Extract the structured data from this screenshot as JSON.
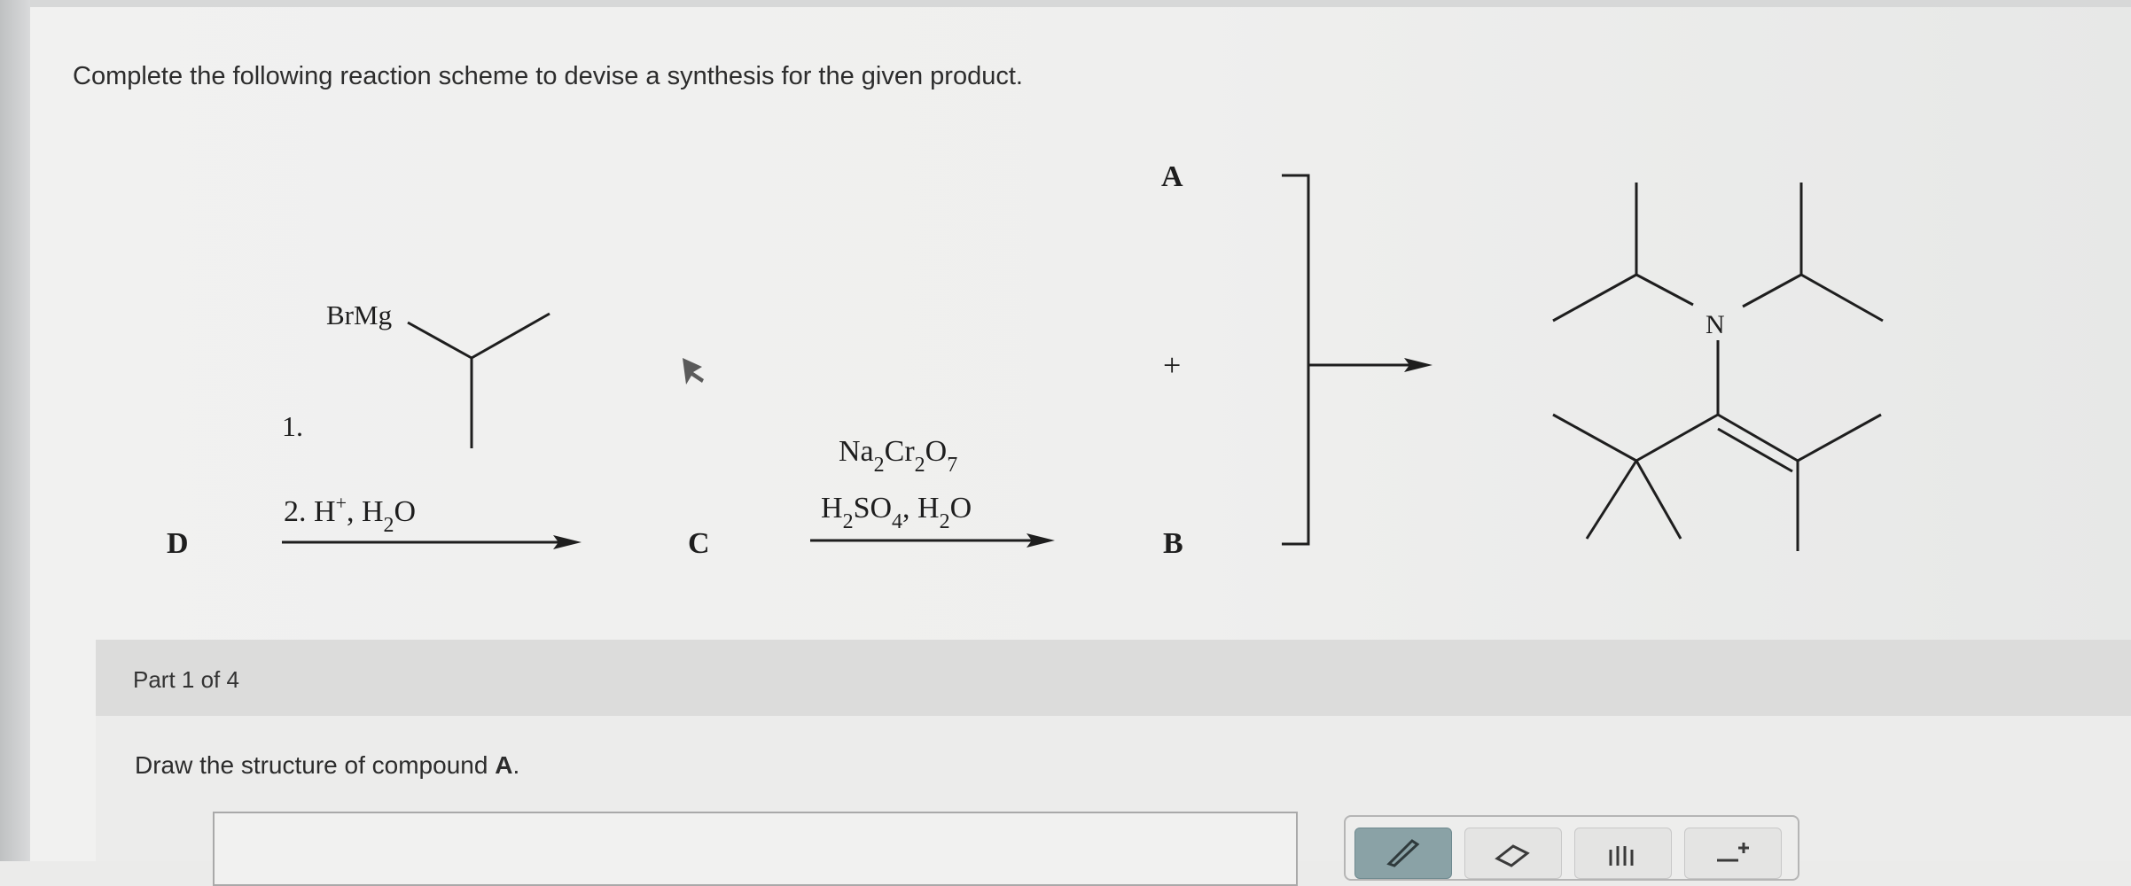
{
  "question": {
    "text": "Complete the following reaction scheme to devise a synthesis for the given product."
  },
  "scheme": {
    "compound_d": "D",
    "compound_c": "C",
    "compound_a": "A",
    "compound_b": "B",
    "plus": "+",
    "step1_reagent_label": "BrMg",
    "step1_number": "1.",
    "step2_prefix": "2. H",
    "step2_sup": "+",
    "step2_mid": ", H",
    "step2_sub": "2",
    "step2_end": "O",
    "ox_line1": {
      "a": "Na",
      "s1": "2",
      "b": "Cr",
      "s2": "2",
      "c": "O",
      "s3": "7"
    },
    "ox_line2": {
      "a": "H",
      "s1": "2",
      "b": "SO",
      "s2": "4",
      "c": ", H",
      "s3": "2",
      "d": "O"
    },
    "product_atom": "N"
  },
  "part": {
    "label": "Part 1 of 4",
    "prompt_prefix": "Draw the structure of compound ",
    "prompt_bold": "A",
    "prompt_suffix": "."
  },
  "toolbar": {
    "tools": [
      "pencil-icon",
      "eraser-icon",
      "hand-icon",
      "add-structure-icon"
    ]
  }
}
